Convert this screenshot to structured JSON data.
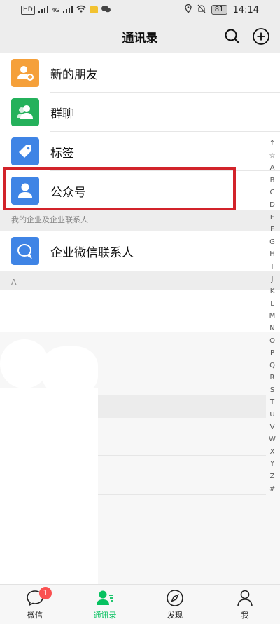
{
  "status_bar": {
    "left_chips": [
      "HD",
      "4G",
      "4G"
    ],
    "battery": "81",
    "time": "14:14"
  },
  "header": {
    "title": "通讯录",
    "icons": [
      "search-icon",
      "add-icon"
    ]
  },
  "contacts_menu": [
    {
      "label": "新的朋友",
      "color": "#f5a03a",
      "icon": "add-friend-icon"
    },
    {
      "label": "群聊",
      "color": "#24b15b",
      "icon": "group-icon"
    },
    {
      "label": "标签",
      "color": "#3f84e5",
      "icon": "tag-icon"
    },
    {
      "label": "公众号",
      "color": "#3f84e5",
      "icon": "official-account-icon"
    }
  ],
  "enterprise_section": {
    "header": "我的企业及企业联系人",
    "item": {
      "label": "企业微信联系人",
      "color": "#3f84e5",
      "icon": "wecom-contacts-icon"
    }
  },
  "contact_section_header": "A",
  "alphabet_index": [
    "↑",
    "☆",
    "A",
    "B",
    "C",
    "D",
    "E",
    "F",
    "G",
    "H",
    "I",
    "J",
    "K",
    "L",
    "M",
    "N",
    "O",
    "P",
    "Q",
    "R",
    "S",
    "T",
    "U",
    "V",
    "W",
    "X",
    "Y",
    "Z",
    "#"
  ],
  "tab_bar": {
    "tabs": [
      {
        "label": "微信",
        "icon": "chat-icon",
        "badge": "1"
      },
      {
        "label": "通讯录",
        "icon": "contacts-icon",
        "active": true
      },
      {
        "label": "发现",
        "icon": "compass-icon"
      },
      {
        "label": "我",
        "icon": "profile-icon"
      }
    ]
  },
  "colors": {
    "accent": "#07c160",
    "highlight_border": "#d2232a",
    "badge": "#fa5151"
  }
}
